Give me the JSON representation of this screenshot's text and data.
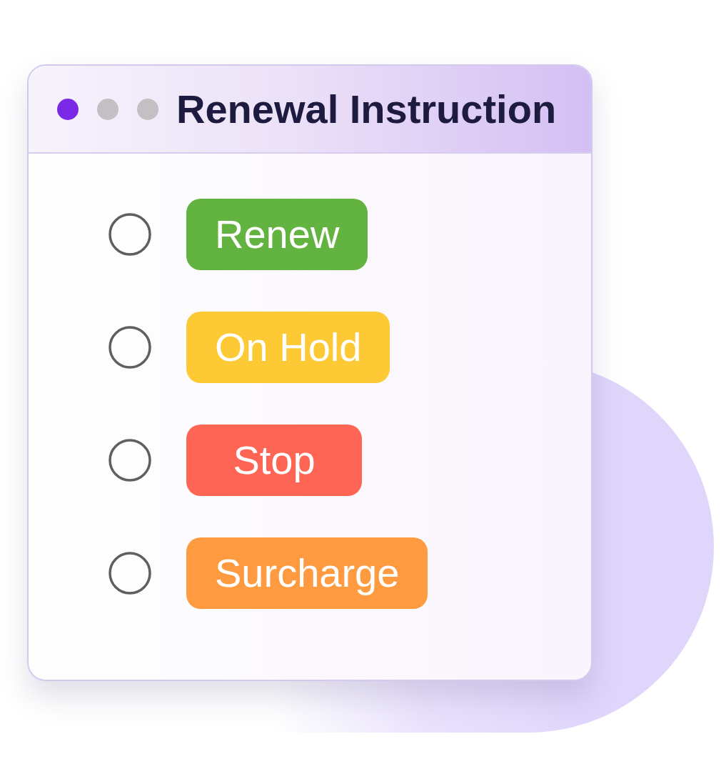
{
  "window": {
    "title": "Renewal Instruction",
    "controls": [
      {
        "color": "#7a2ae6"
      },
      {
        "color": "#c3c0c3"
      },
      {
        "color": "#c3c0c3"
      }
    ]
  },
  "options": [
    {
      "label": "Renew",
      "color": "#63b340",
      "selected": false
    },
    {
      "label": "On Hold",
      "color": "#fdc934",
      "selected": false
    },
    {
      "label": "Stop",
      "color": "#ff6554",
      "selected": false
    },
    {
      "label": "Surcharge",
      "color": "#fe9b40",
      "selected": false
    }
  ]
}
